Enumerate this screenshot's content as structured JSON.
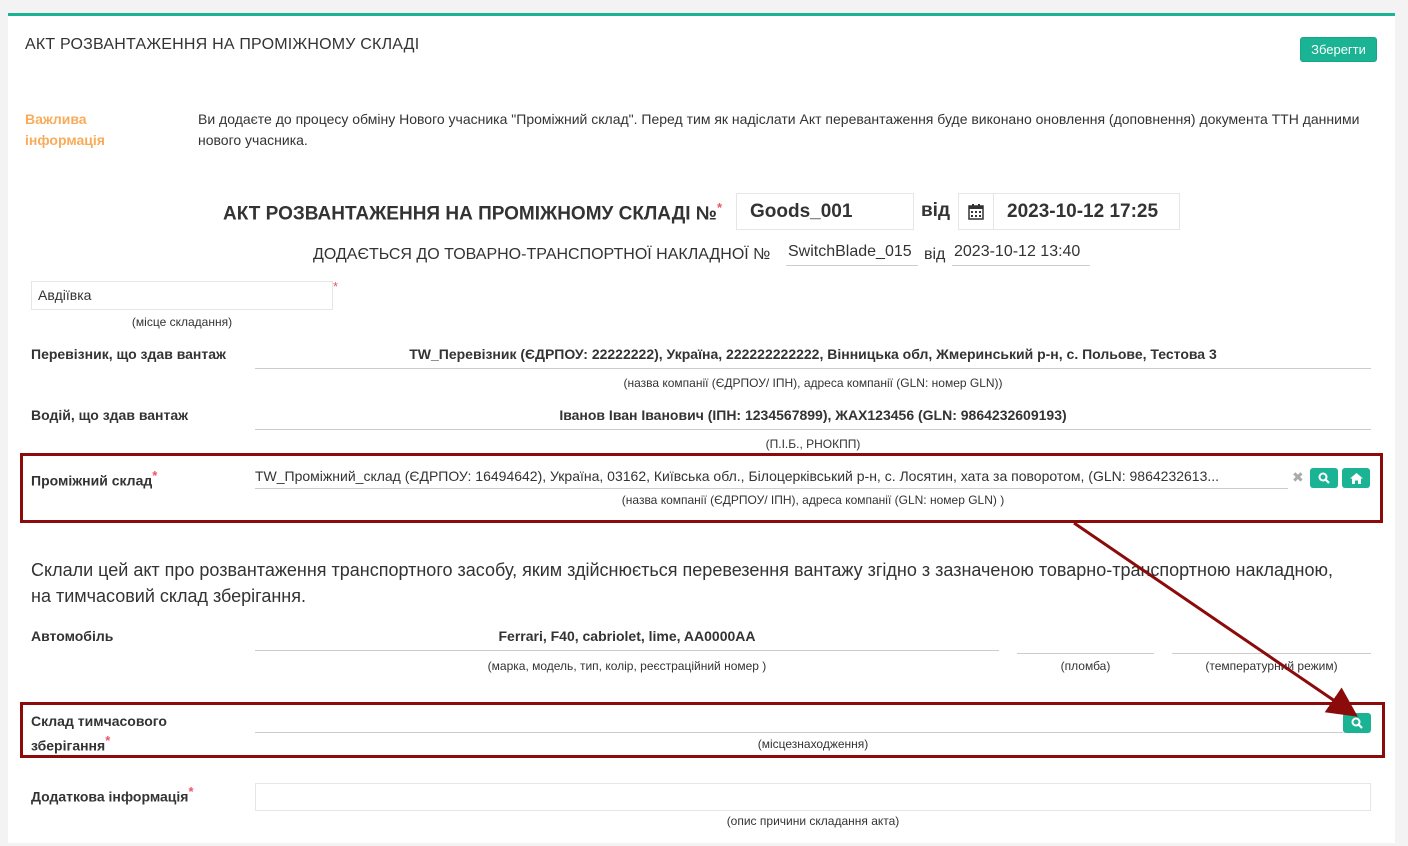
{
  "header": {
    "title": "АКТ РОЗВАНТАЖЕННЯ НА ПРОМІЖНОМУ СКЛАДІ",
    "save_label": "Зберегти"
  },
  "info": {
    "label": "Важлива інформація",
    "text": "Ви додаєте до процесу обміну Нового учасника \"Проміжний склад\". Перед тим як надіслати Акт перевантаження буде виконано оновлення (доповнення) документа ТТН данними нового учасника."
  },
  "doc": {
    "title": "АКТ РОЗВАНТАЖЕННЯ НА ПРОМІЖНОМУ СКЛАДІ №",
    "required_mark": "*",
    "number": "Goods_001",
    "vid": "від",
    "datetime": "2023-10-12 17:25",
    "subtitle": "ДОДАЄТЬСЯ ДО ТОВАРНО-ТРАНСПОРТНОЇ НАКЛАДНОЇ №",
    "ttn_number": "SwitchBlade_015",
    "ttn_vid": "від",
    "ttn_date": "2023-10-12 13:40"
  },
  "place": {
    "value": "Авдіївка",
    "hint": "(місце складання)"
  },
  "carrier": {
    "label": "Перевізник, що здав вантаж",
    "value": "TW_Перевізник (ЄДРПОУ: 22222222), Україна, 222222222222, Вінницька обл, Жмеринський р-н, с. Польове, Тестова 3",
    "hint": "(назва компанії (ЄДРПОУ/ ІПН), адреса компанії (GLN: номер GLN))"
  },
  "driver": {
    "label": "Водій, що здав вантаж",
    "value": "Іванов Іван Іванович (ІПН: 1234567899), ЖАХ123456 (GLN: 9864232609193)",
    "hint": "(П.І.Б., РНОКПП)"
  },
  "warehouse": {
    "label": "Проміжний склад",
    "value": "TW_Проміжний_склад (ЄДРПОУ: 16494642), Україна, 03162, Київська обл., Білоцерківський р-н, с. Лосятин, хата за поворотом, (GLN: 9864232613...",
    "hint": "(назва компанії (ЄДРПОУ/ ІПН), адреса компанії (GLN: номер GLN) )"
  },
  "paragraph": "Склали цей акт про розвантаження транспортного засобу, яким здійснюється перевезення вантажу згідно з зазначеною товарно-транспортною накладною, на тимчасовий склад зберігання.",
  "vehicle": {
    "label": "Автомобіль",
    "value": "Ferrari, F40, cabriolet, lime, AA0000AA",
    "hint": "(марка, модель, тип, колір, реєстраційний номер )",
    "seal_hint": "(пломба)",
    "temp_hint": "(температурний режим)"
  },
  "storage": {
    "label_line1": "Склад тимчасового",
    "label_line2": "зберігання",
    "hint": "(місцезнаходження)"
  },
  "additional": {
    "label": "Додаткова інформація",
    "hint": "(опис причини складання акта)"
  },
  "colors": {
    "accent": "#1ab394",
    "warning": "#f8ac59",
    "highlight": "#8b0a0a",
    "required": "#ed5565"
  }
}
